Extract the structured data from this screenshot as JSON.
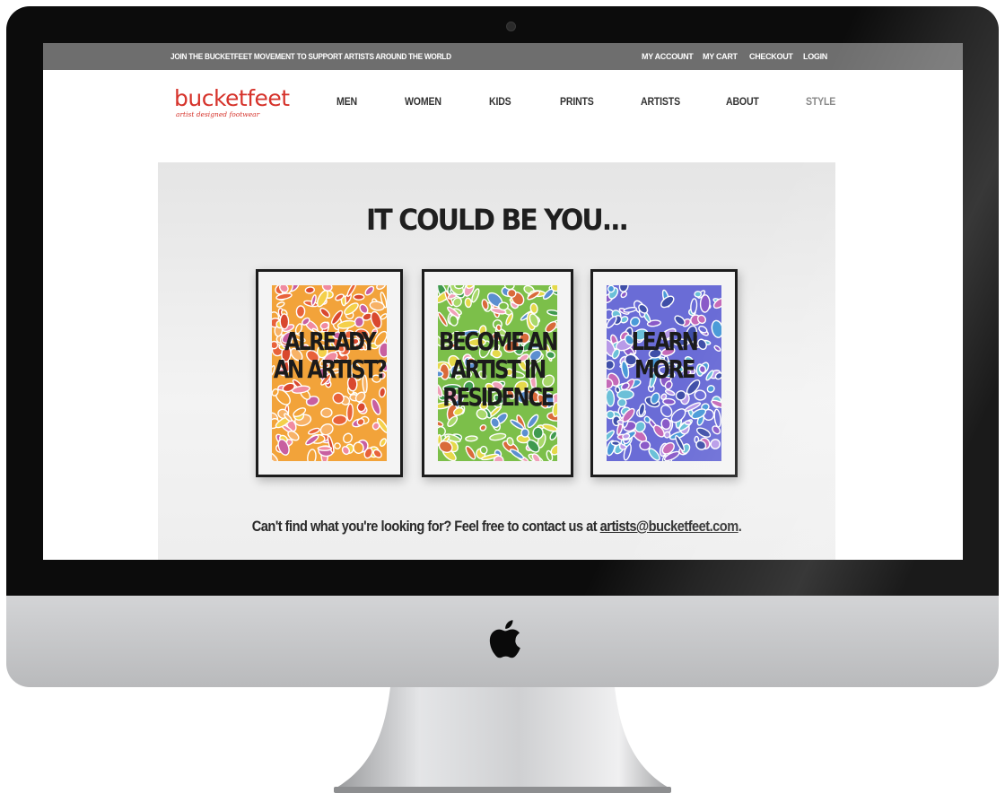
{
  "topbar": {
    "promo": "JOIN THE BUCKETFEET MOVEMENT TO SUPPORT ARTISTS AROUND THE WORLD",
    "links": [
      "MY ACCOUNT",
      "MY CART",
      "CHECKOUT",
      "LOGIN"
    ]
  },
  "brand": {
    "name": "bucketfeet",
    "tagline": "artist designed footwear",
    "color": "#d6332b"
  },
  "nav": {
    "items": [
      "MEN",
      "WOMEN",
      "KIDS",
      "PRINTS",
      "ARTISTS",
      "ABOUT",
      "STYLE"
    ]
  },
  "hero": {
    "title": "IT COULD BE YOU...",
    "frames": [
      {
        "label": "ALREADY AN ARTIST?",
        "palette": "warm"
      },
      {
        "label": "BECOME AN ARTIST IN RESIDENCE",
        "palette": "green"
      },
      {
        "label": "LEARN MORE",
        "palette": "purple"
      }
    ],
    "contact_text": "Can't find what you're looking for? Feel free to contact us at",
    "contact_email": "artists@bucketfeet.com",
    "contact_end": "."
  },
  "device": {
    "logo_icon": "apple-logo-icon"
  }
}
